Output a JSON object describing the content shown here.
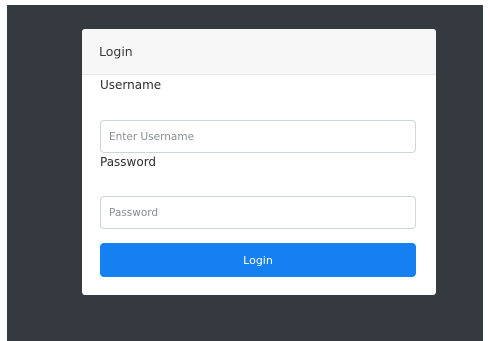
{
  "login_card": {
    "header_title": "Login",
    "username_label": "Username",
    "username_placeholder": "Enter Username",
    "password_label": "Password",
    "password_placeholder": "Password",
    "submit_label": "Login"
  },
  "colors": {
    "backdrop": "#343a40",
    "primary_button": "#1580f2",
    "card_header_bg": "#f7f7f7"
  }
}
